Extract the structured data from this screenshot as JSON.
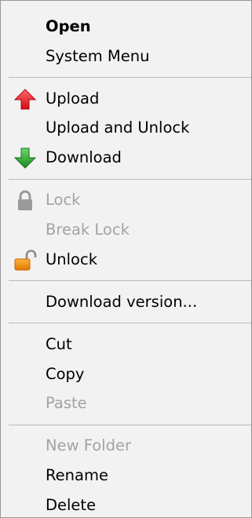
{
  "menu": {
    "groups": [
      {
        "items": [
          {
            "label": "Open",
            "bold": true
          },
          {
            "label": "System Menu"
          }
        ]
      },
      {
        "items": [
          {
            "label": "Upload",
            "icon": "upload-arrow-icon"
          },
          {
            "label": "Upload and Unlock"
          },
          {
            "label": "Download",
            "icon": "download-arrow-icon"
          }
        ]
      },
      {
        "items": [
          {
            "label": "Lock",
            "icon": "lock-icon",
            "disabled": true
          },
          {
            "label": "Break Lock",
            "disabled": true
          },
          {
            "label": "Unlock",
            "icon": "unlock-icon"
          }
        ]
      },
      {
        "items": [
          {
            "label": "Download version..."
          }
        ]
      },
      {
        "items": [
          {
            "label": "Cut"
          },
          {
            "label": "Copy"
          },
          {
            "label": "Paste",
            "disabled": true
          }
        ]
      },
      {
        "items": [
          {
            "label": "New Folder",
            "disabled": true
          },
          {
            "label": "Rename"
          },
          {
            "label": "Delete"
          }
        ]
      }
    ]
  },
  "colors": {
    "menu_background": "#f2f2f2",
    "disabled_text": "#a3a3a3",
    "upload_arrow": "#e8141b",
    "download_arrow": "#2aa12a",
    "lock_gray": "#9a9a9a",
    "unlock_orange": "#f08c00"
  }
}
